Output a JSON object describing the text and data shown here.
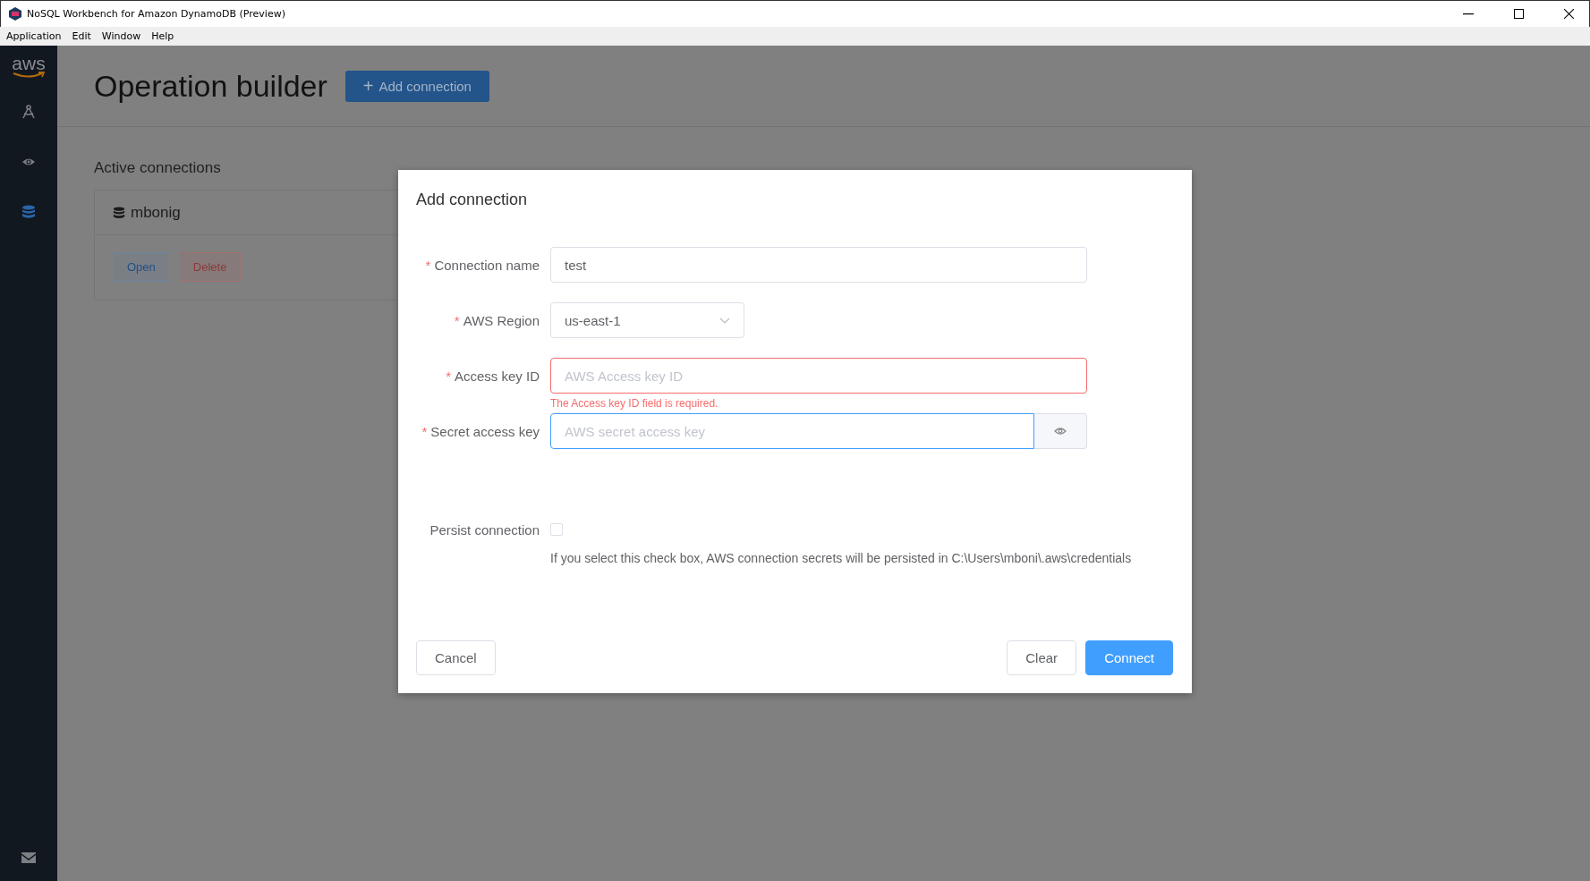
{
  "window": {
    "title": "NoSQL Workbench for Amazon DynamoDB (Preview)"
  },
  "menu": [
    "Application",
    "Edit",
    "Window",
    "Help"
  ],
  "sidebar": {
    "logo": "aws",
    "items": [
      {
        "kind": "modeler",
        "selected": false
      },
      {
        "kind": "visualizer",
        "selected": false
      },
      {
        "kind": "database",
        "selected": true
      }
    ]
  },
  "page": {
    "title": "Operation builder",
    "add_button": {
      "icon": "+",
      "label": "Add connection"
    },
    "section_title": "Active connections",
    "connections": [
      {
        "name": "mbonig",
        "buttons": [
          {
            "label": "Open",
            "kind": "primary"
          },
          {
            "label": "Delete",
            "kind": "danger"
          }
        ]
      }
    ]
  },
  "dialog": {
    "title": "Add connection",
    "fields": [
      {
        "kind": "text",
        "marker": "*",
        "label": "Connection name",
        "value": "test",
        "focused": false
      },
      {
        "kind": "select",
        "marker": "*",
        "label": "AWS Region",
        "value": "us-east-1",
        "focused": false
      },
      {
        "kind": "text",
        "marker": "*",
        "label": "Access key ID",
        "placeholder": "AWS Access key ID",
        "error": "The Access key ID field is required.",
        "focused": false
      },
      {
        "kind": "secret",
        "marker": "*",
        "label": "Secret access key",
        "placeholder": "AWS secret access key",
        "focused": true
      }
    ],
    "persist": {
      "label": "Persist connection",
      "checked": false
    },
    "note": "If you select this check box, AWS connection secrets will be persisted in C:\\Users\\mboni\\.aws\\credentials",
    "buttons": [
      {
        "label": "Cancel",
        "kind": "default"
      },
      {
        "label": "Clear",
        "kind": "default"
      },
      {
        "label": "Connect",
        "kind": "primary"
      }
    ]
  }
}
